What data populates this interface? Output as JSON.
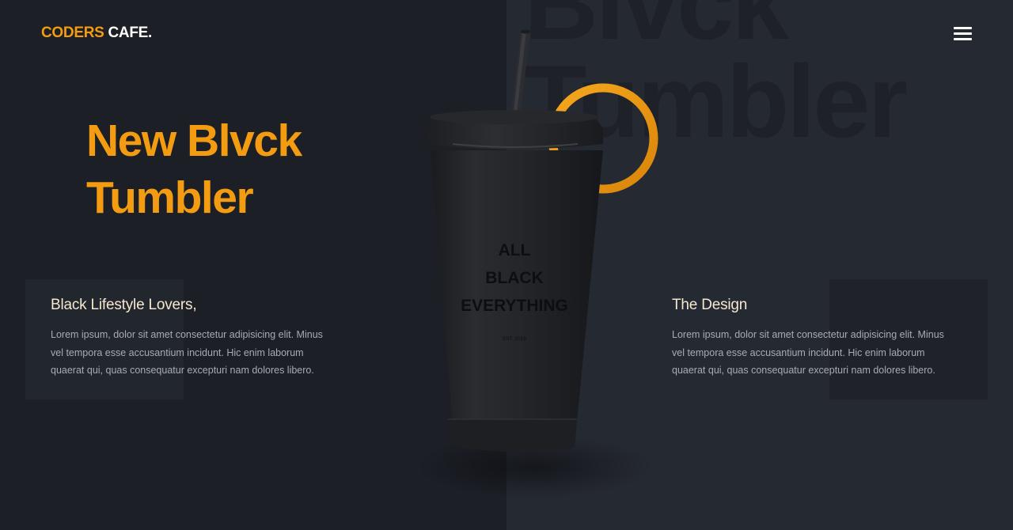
{
  "brand": {
    "name_accent": "CODERS",
    "name_rest": "CAFE."
  },
  "hero": {
    "title_line1": "New Blvck",
    "title_line2": "Tumbler"
  },
  "watermark": {
    "line1": "Blvck",
    "line2": "Tumbler"
  },
  "panels": [
    {
      "heading": "Black Lifestyle Lovers,",
      "text": "Lorem ipsum, dolor sit amet consectetur adipisicing elit. Minus vel tempora esse accusantium incidunt. Hic enim laborum quaerat qui, quas consequatur excepturi nam dolores libero."
    },
    {
      "heading": "The Design",
      "text": "Lorem ipsum, dolor sit amet consectetur adipisicing elit. Minus vel tempora esse accusantium incidunt. Hic enim laborum quaerat qui, quas consequatur excepturi nam dolores libero."
    }
  ],
  "product": {
    "print_line1": "ALL",
    "print_line2": "BLACK",
    "print_line3": "EVERYTHING",
    "print_small": "EST. 2018"
  },
  "icons": {
    "menu": "hamburger-menu-icon"
  },
  "colors": {
    "accent": "#f39c12",
    "background_left": "#1c1f26",
    "background_right": "#252932",
    "heading_text": "#f6e7d0",
    "body_text": "#a8acb2"
  }
}
